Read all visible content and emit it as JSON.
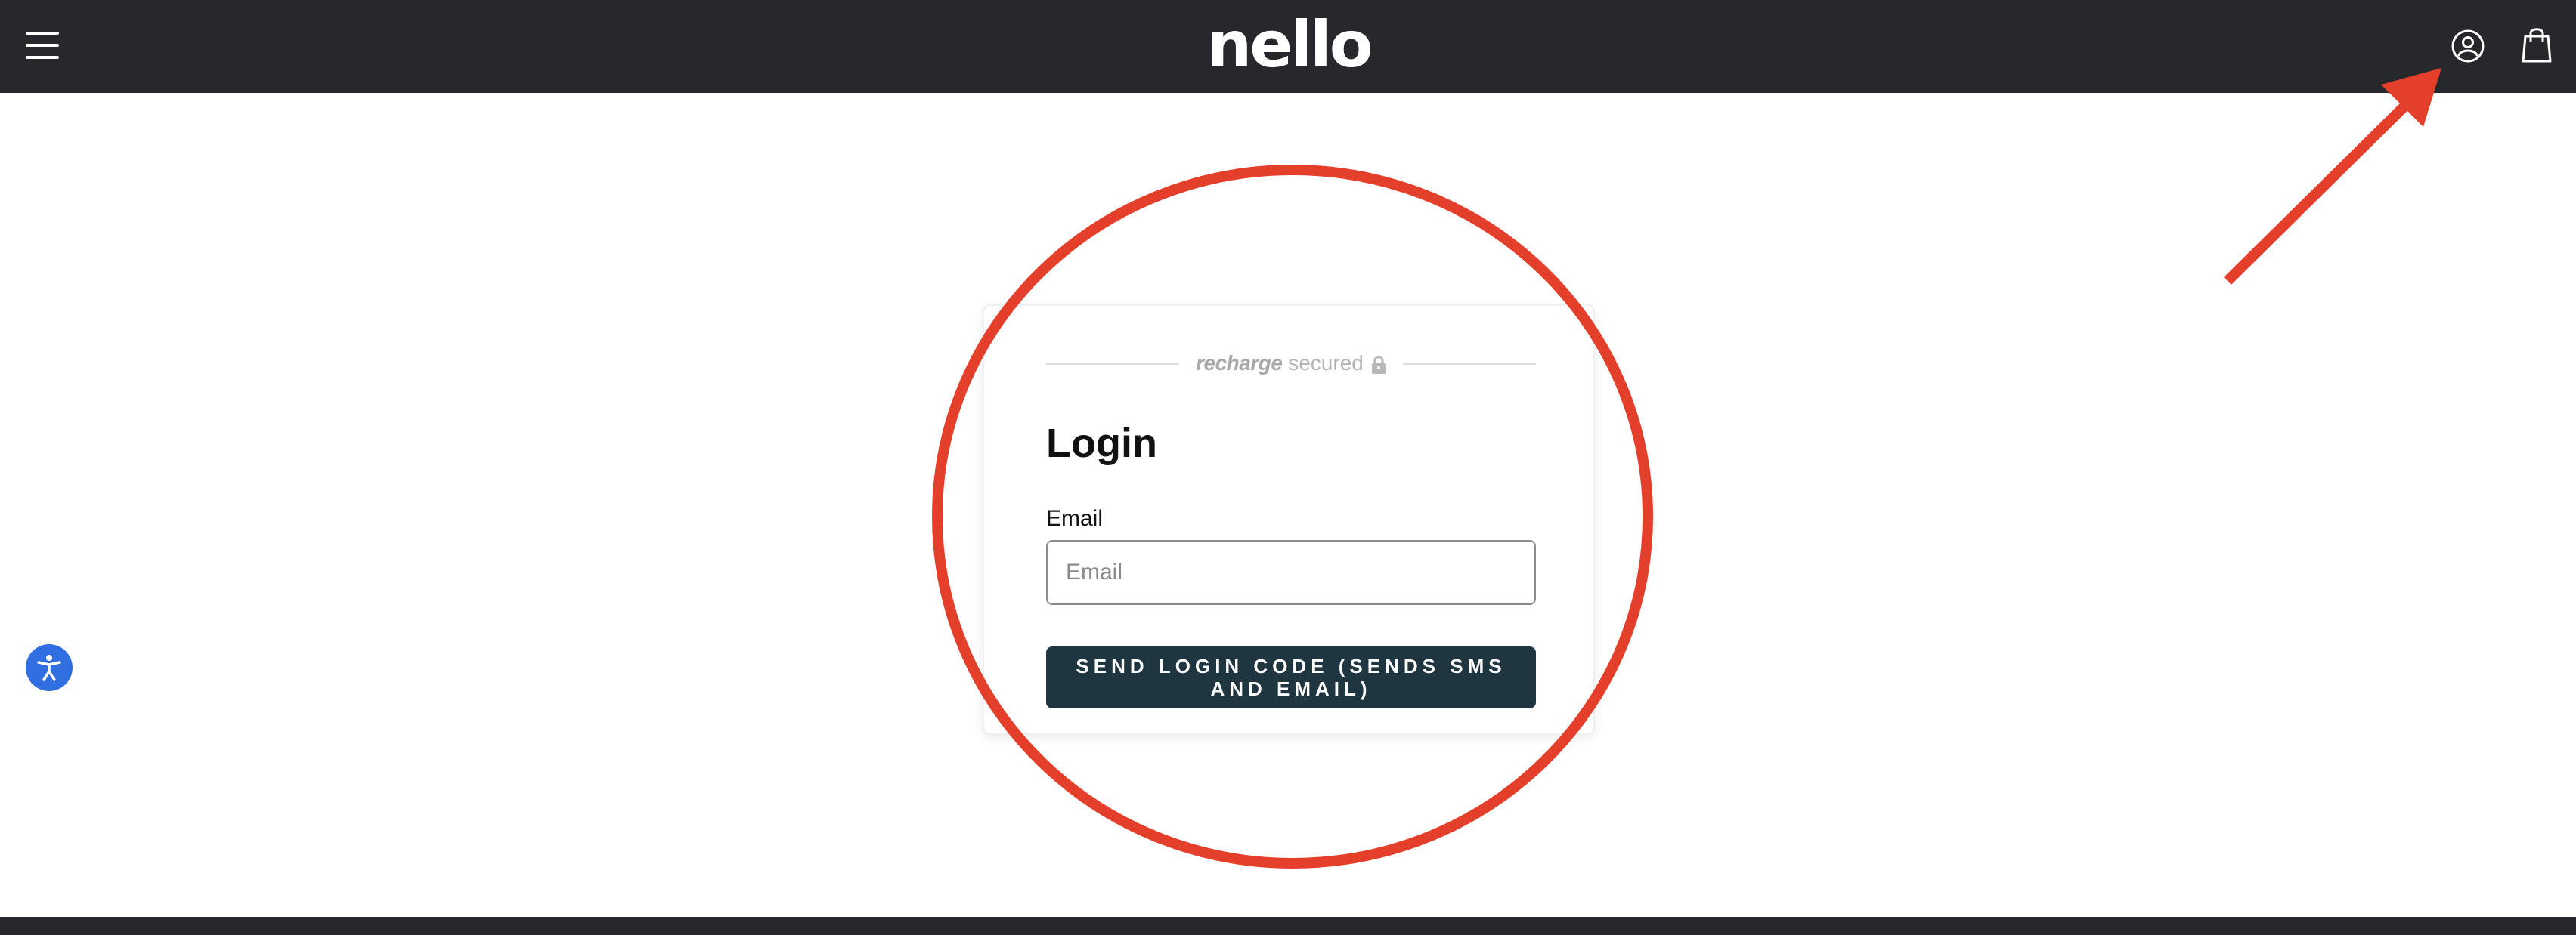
{
  "header": {
    "logo_text": "nello",
    "menu_icon": "hamburger-menu-icon",
    "account_icon": "user-account-icon",
    "cart_icon": "shopping-bag-icon",
    "background_color": "#27282b"
  },
  "login": {
    "secured_brand": "recharge",
    "secured_text": "secured",
    "lock_icon": "lock-icon",
    "title": "Login",
    "email_label": "Email",
    "email_placeholder": "Email",
    "email_value": "",
    "send_button_label": "SEND LOGIN CODE (SENDS SMS AND EMAIL)",
    "button_color": "#1f3540"
  },
  "accessibility": {
    "icon": "accessibility-icon",
    "color": "#2f6fe0"
  },
  "annotations": {
    "color": "#e43f2a",
    "circle_target": "login-card",
    "arrow_target": "account-button"
  }
}
